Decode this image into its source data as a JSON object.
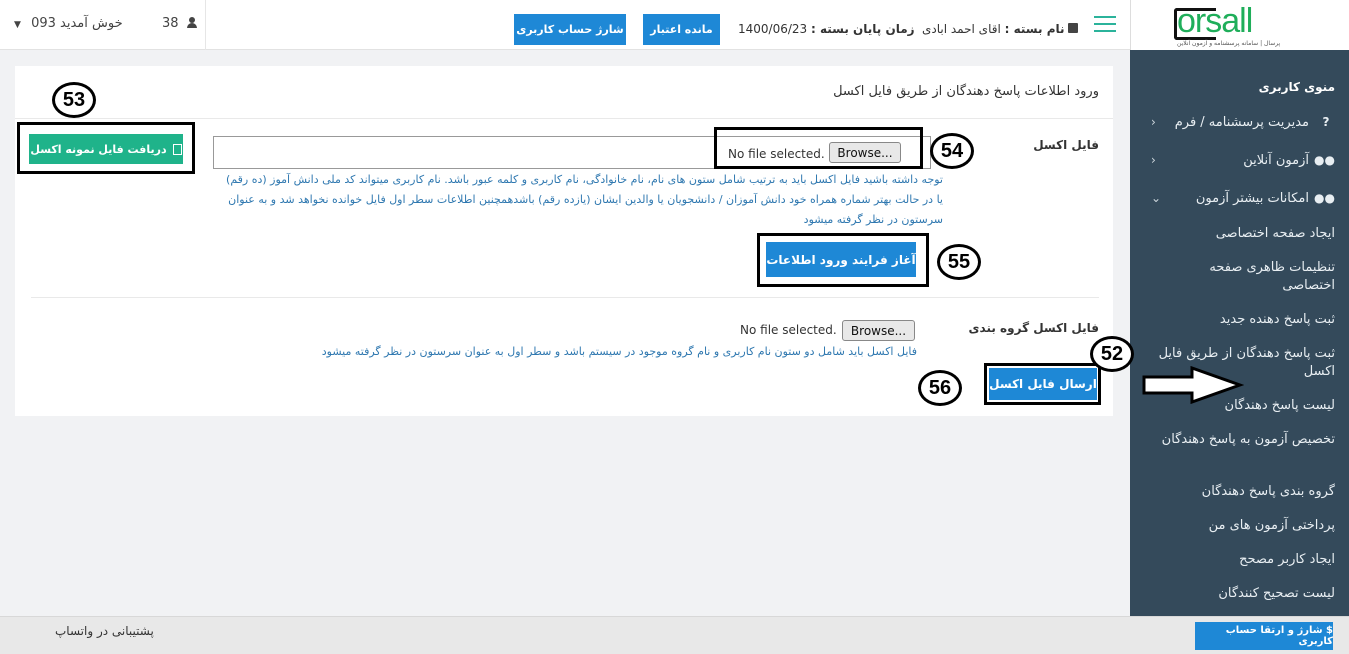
{
  "header": {
    "welcome": "093 خوش آمدید",
    "user_count": "38",
    "charge_account_label": "شارژ حساب کاربری",
    "balance_label": "مانده اعتبار",
    "end_date_label": "زمان پایان بسته :",
    "end_date_value": "1400/06/23",
    "package_label": "نام بسته :",
    "package_value": "اقای احمد ابادی"
  },
  "logo": {
    "text": "orsall",
    "subtitle": "پرسال | سامانه پرسشنامه و آزمون آنلاین"
  },
  "sidebar": {
    "title": "منوی کاربری",
    "items": [
      {
        "label": "مدیریت پرسشنامه / فرم",
        "icon": "question-icon"
      },
      {
        "label": "آزمون آنلاین",
        "icon": "users-icon"
      },
      {
        "label": "امکانات بیشتر آزمون",
        "icon": "users-icon"
      }
    ],
    "subitems": [
      "ایجاد صفحه اختصاصی",
      "تنظیمات ظاهری صفحه اختصاصی",
      "ثبت پاسخ دهنده جدید",
      "ثبت پاسخ دهندگان از طریق فایل اکسل",
      "لیست پاسخ دهندگان",
      "تخصیص آزمون به پاسخ دهندگان",
      "گروه بندی پاسخ دهندگان",
      "پرداختی آزمون های من",
      "ایجاد کاربر مصحح",
      "لیست تصحیح کنندگان"
    ]
  },
  "main": {
    "title": "ورود اطلاعات پاسخ دهندگان از طریق فایل اکسل",
    "excel_label": "فایل اکسل",
    "browse_label": "Browse...",
    "no_file": "No file selected.",
    "help_text": "توجه داشته باشید فایل اکسل باید به ترتیب شامل ستون های نام، نام خانوادگی، نام کاربری و کلمه عبور باشد. نام کاربری میتواند کد ملی دانش آموز (ده رقم) یا در حالت بهتر شماره همراه خود دانش آموزان / دانشجویان یا والدین ایشان (یازده رقم) باشدهمچنین اطلاعات سطر اول فایل خوانده نخواهد شد و به عنوان سرستون در نظر گرفته میشود",
    "sample_button": "دریافت فایل نمونه اکسل",
    "start_button": "آغاز فرایند ورود اطلاعات",
    "group_label": "فایل اکسل گروه بندی",
    "group_help": "فایل اکسل باید شامل دو ستون نام کاربری و نام گروه موجود در سیستم باشد و سطر اول به عنوان سرستون در نظر گرفته میشود",
    "send_button": "ارسال فایل اکسل"
  },
  "annotations": [
    "52",
    "53",
    "54",
    "55",
    "56"
  ],
  "footer": {
    "whatsapp": "پشتیبانی در واتساپ",
    "upgrade_button": "$ شارژ و ارتقا حساب کاربری"
  },
  "colors": {
    "accent_blue": "#1e88d6",
    "accent_green": "#1fb38a",
    "sidebar_bg": "#344a5b",
    "help_text": "#2f78b0"
  }
}
